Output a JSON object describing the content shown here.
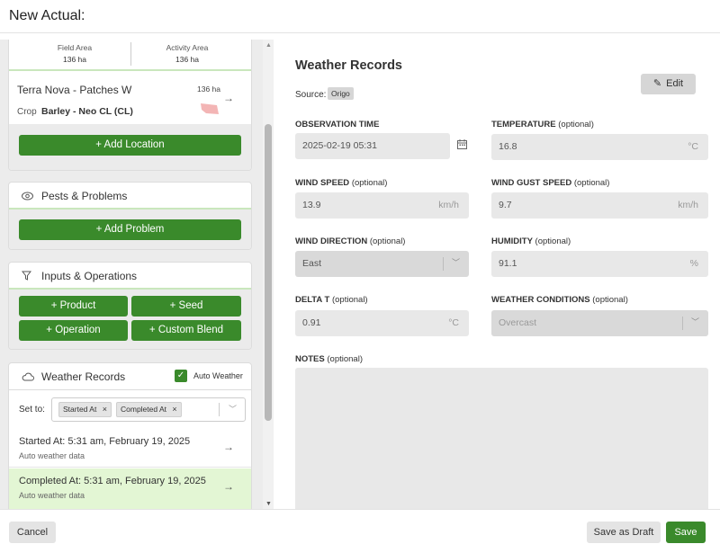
{
  "header": {
    "title": "New Actual:"
  },
  "left": {
    "location_card": {
      "field_area_label": "Field Area",
      "field_area_value": "136 ha",
      "activity_area_label": "Activity Area",
      "activity_area_value": "136 ha",
      "location_name": "Terra Nova - Patches W",
      "location_area": "136 ha",
      "crop_label": "Crop",
      "crop_value": "Barley - Neo CL (CL)",
      "add_location_label": "+ Add Location"
    },
    "pests_card": {
      "title": "Pests & Problems",
      "add_problem_label": "+ Add Problem"
    },
    "inputs_card": {
      "title": "Inputs & Operations",
      "buttons": [
        "+ Product",
        "+ Seed",
        "+ Operation",
        "+ Custom Blend"
      ]
    },
    "weather_card": {
      "title": "Weather Records",
      "auto_weather_label": "Auto Weather",
      "auto_weather_checked": true,
      "set_to_label": "Set to:",
      "tags": [
        "Started At",
        "Completed At"
      ],
      "records": [
        {
          "title": "Started At: 5:31 am, February 19, 2025",
          "subtitle": "Auto weather data"
        },
        {
          "title": "Completed At: 5:31 am, February 19, 2025",
          "subtitle": "Auto weather data"
        }
      ]
    }
  },
  "right": {
    "title": "Weather Records",
    "source_label": "Source:",
    "source_value": "Origo",
    "edit_label": "Edit",
    "fields": {
      "observation_time": {
        "label_bold": "OBSERVATION TIME",
        "label_rest": "",
        "value": "2025-02-19 05:31"
      },
      "temperature": {
        "label_bold": "TEMPERATURE",
        "label_rest": " (optional)",
        "value": "16.8",
        "unit": "°C"
      },
      "wind_speed": {
        "label_bold": "WIND SPEED",
        "label_rest": " (optional)",
        "value": "13.9",
        "unit": "km/h"
      },
      "wind_gust": {
        "label_bold": "WIND GUST SPEED",
        "label_rest": " (optional)",
        "value": "9.7",
        "unit": "km/h"
      },
      "wind_direction": {
        "label_bold": "WIND DIRECTION",
        "label_rest": " (optional)",
        "value": "East"
      },
      "humidity": {
        "label_bold": "HUMIDITY",
        "label_rest": " (optional)",
        "value": "91.1",
        "unit": "%"
      },
      "delta_t": {
        "label_bold": "DELTA T",
        "label_rest": " (optional)",
        "value": "0.91",
        "unit": "°C"
      },
      "weather_conditions": {
        "label_bold": "WEATHER CONDITIONS",
        "label_rest": " (optional)",
        "value": "Overcast"
      },
      "notes": {
        "label_bold": "NOTES",
        "label_rest": " (optional)",
        "value": ""
      }
    }
  },
  "footer": {
    "cancel_label": "Cancel",
    "draft_label": "Save as Draft",
    "save_label": "Save"
  },
  "colors": {
    "accent_green": "#3a8a2b",
    "selected_row": "#e3f6d4",
    "tab_underline": "#c9e7bd"
  }
}
